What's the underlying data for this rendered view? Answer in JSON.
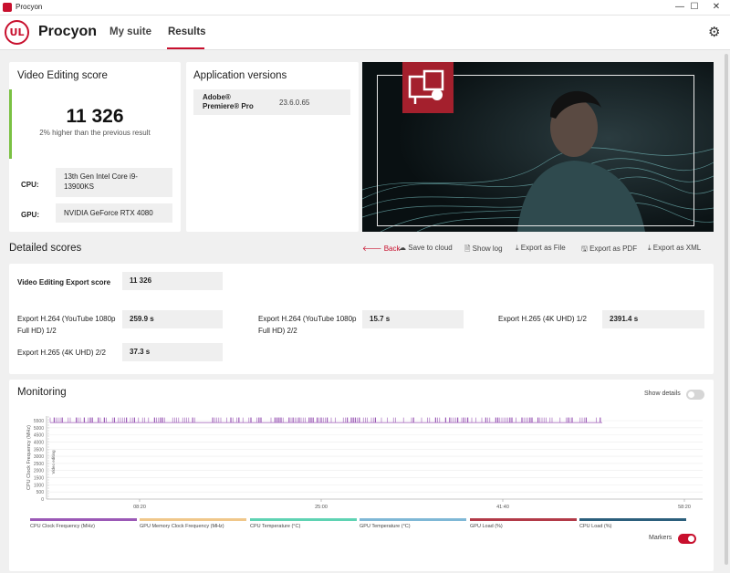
{
  "window": {
    "title": "Procyon",
    "minimize": "—",
    "maximize": "☐",
    "close": "✕"
  },
  "header": {
    "logo": "UL",
    "brand": "Procyon",
    "nav": [
      {
        "label": "My suite"
      },
      {
        "label": "Results"
      }
    ]
  },
  "score_card": {
    "title": "Video Editing score",
    "score": "11 326",
    "comparison": "2% higher than the previous result",
    "cpu_label": "CPU:",
    "cpu_value": "13th Gen Intel Core i9-13900KS",
    "gpu_label": "GPU:",
    "gpu_value": "NVIDIA GeForce RTX 4080"
  },
  "versions_card": {
    "title": "Application versions",
    "app_name": "Adobe® Premiere® Pro",
    "app_version": "23.6.0.65"
  },
  "detailed": {
    "title": "Detailed scores",
    "actions": {
      "back": "Back",
      "save_cloud": "Save to cloud",
      "show_log": "Show log",
      "export_file": "Export as File",
      "export_pdf": "Export as PDF",
      "export_xml": "Export as XML"
    },
    "export_score_label": "Video Editing Export score",
    "export_score_value": "11 326",
    "items": [
      {
        "label": "Export H.264 (YouTube 1080p Full HD) 1/2",
        "value": "259.9 s"
      },
      {
        "label": "Export H.264 (YouTube 1080p Full HD) 2/2",
        "value": "15.7 s"
      },
      {
        "label": "Export H.265 (4K UHD) 1/2",
        "value": "2391.4 s"
      },
      {
        "label": "Export H.265 (4K UHD) 2/2",
        "value": "37.3 s"
      }
    ]
  },
  "monitoring": {
    "title": "Monitoring",
    "show_details": "Show details",
    "show_details_on": false,
    "markers": "Markers",
    "markers_on": true,
    "y_axis_label": "CPU Clock Frequency (MHz)",
    "marker_label": "Video editing",
    "y_ticks": [
      "5500",
      "5000",
      "4500",
      "4000",
      "3500",
      "3000",
      "2500",
      "2000",
      "1500",
      "1000",
      "500",
      "0"
    ],
    "x_ticks": [
      "08:20",
      "25:00",
      "41:40",
      "58:20"
    ],
    "legend": [
      {
        "label": "CPU Clock Frequency (MHz)",
        "color": "#9b59b6"
      },
      {
        "label": "GPU Memory Clock Frequency (MHz)",
        "color": "#f0c78a"
      },
      {
        "label": "CPU Temperature (°C)",
        "color": "#5fd3b3"
      },
      {
        "label": "GPU Temperature (°C)",
        "color": "#7fb8d6"
      },
      {
        "label": "GPU Load (%)",
        "color": "#b23a48"
      },
      {
        "label": "CPU Load (%)",
        "color": "#2c5f7c"
      }
    ]
  },
  "chart_data": {
    "type": "line",
    "title": "",
    "xlabel": "",
    "ylabel": "CPU Clock Frequency (MHz)",
    "x_ticks": [
      "08:20",
      "25:00",
      "41:40",
      "58:20"
    ],
    "ylim": [
      0,
      5800
    ],
    "series": [
      {
        "name": "CPU Clock Frequency (MHz)",
        "values": [
          5700,
          5600,
          5700,
          5650,
          5700,
          5600,
          5700,
          5700
        ]
      }
    ]
  },
  "colors": {
    "accent": "#c8102e",
    "score_bar": "#7ac143",
    "cpu_series": "#9b59b6"
  }
}
